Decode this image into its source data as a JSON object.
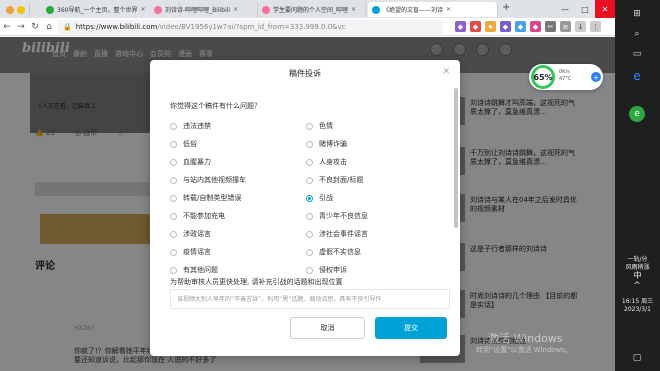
{
  "browser": {
    "tabs": [
      {
        "label": "360导航_一个主页，整个世界",
        "color": "#2ea843"
      },
      {
        "label": "刘诗诗-哔哩哔哩_Bilibili",
        "color": "#fb7299"
      },
      {
        "label": "学生要问题的个人空间_哔哩",
        "color": "#fb7299"
      },
      {
        "label": "《绝望的文盲——刘诗",
        "color": "#00a1d6"
      }
    ],
    "url_host": "https://www.bilibili.com",
    "url_path": "/video/BV1956y1w7ai/?spm_id_from=333.999.0.0&vc",
    "window_controls": [
      "—",
      "□",
      "✕"
    ]
  },
  "site": {
    "logo": "bilibili",
    "nav": [
      "首页",
      "番剧",
      "直播",
      "游戏中心",
      "会员购",
      "漫画",
      "赛事"
    ],
    "view_stats": "1人正在看，已装填 1",
    "actions": [
      {
        "icon": "like-icon",
        "label": "23"
      },
      {
        "icon": "coin-icon",
        "label": "投币"
      },
      {
        "icon": "star-icon",
        "label": ""
      }
    ],
    "comments_title": "评论",
    "comment_user": "HXZ87",
    "comment_text": "你疯了!？你解看她平年缘这那不参加，她自己也曾自己不解你说说的那种，周围的人也你说过为你，起码你就要还知道诉说，比起那你现在 人说的不好多了"
  },
  "recommendations": [
    "刘诗诗跳舞才叫高端，这视死的气质太撑了，莫急维真漂...",
    "千万别让刘诗诗跳舞，这视死的气质太撑了，莫急维真漂...",
    "刘诗诗与某人在04年之后发时具优的视频素材",
    "这是子行者那样的刘诗诗",
    "时尚刘诗诗的几个理由 【目前的都是实话】",
    "刘诗诗最美的绝色"
  ],
  "modal": {
    "title": "稿件投诉",
    "question": "你觉得这个稿件有什么问题？",
    "reasons": [
      {
        "label": "违法违禁",
        "checked": false
      },
      {
        "label": "色情",
        "checked": false
      },
      {
        "label": "低俗",
        "checked": false
      },
      {
        "label": "赌博诈骗",
        "checked": false
      },
      {
        "label": "血腥暴力",
        "checked": false
      },
      {
        "label": "人身攻击",
        "checked": false
      },
      {
        "label": "与站内其他视频撞车",
        "checked": false
      },
      {
        "label": "不良封面/标题",
        "checked": false
      },
      {
        "label": "转载/自制类型错误",
        "checked": false
      },
      {
        "label": "引战",
        "checked": true
      },
      {
        "label": "不能参加充电",
        "checked": false
      },
      {
        "label": "青少年不良信息",
        "checked": false
      },
      {
        "label": "涉政谣言",
        "checked": false
      },
      {
        "label": "涉社会事件谣言",
        "checked": false
      },
      {
        "label": "疫情谣言",
        "checked": false
      },
      {
        "label": "虚假不实信息",
        "checked": false
      },
      {
        "label": "有其他问题",
        "checked": false
      },
      {
        "label": "侵权申诉",
        "checked": false
      }
    ],
    "help_text": "为帮助审核人员更快处理, 请补充引战的话题和出现位置",
    "textarea_value": "该视频大别人早年的“不善言辞”，利用“黑”话题，煽动流思，具有不良引导作",
    "cancel": "取消",
    "submit": "提交"
  },
  "speed_widget": {
    "percent": "65%",
    "up": "0K/s",
    "down": "47°C"
  },
  "watermark": {
    "line1": "激活 Windows",
    "line2": "转到\"设置\"以激活 Windows。"
  },
  "taskbar": {
    "weather": "一轨/分",
    "weather2": "风雨稍涨",
    "ime": "中",
    "time": "16:15 周三",
    "date": "2023/3/1"
  }
}
